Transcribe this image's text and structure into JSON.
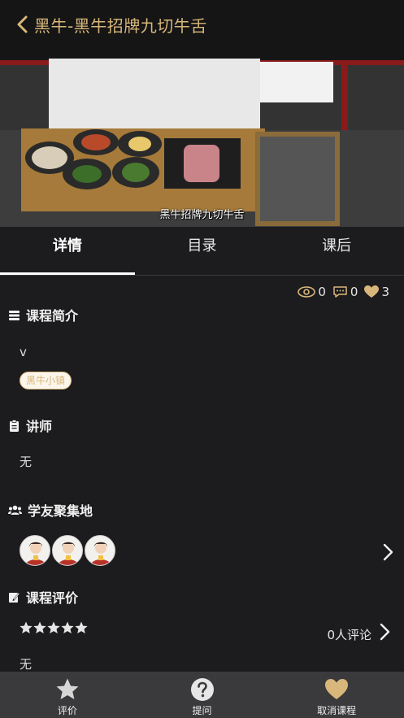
{
  "header": {
    "title": "黑牛-黑牛招牌九切牛舌",
    "video_subtitle": "黑牛招牌九切牛舌"
  },
  "tabs": [
    {
      "label": "详情",
      "active": true
    },
    {
      "label": "目录",
      "active": false
    },
    {
      "label": "课后",
      "active": false
    }
  ],
  "stats": {
    "views": "0",
    "comments": "0",
    "likes": "3"
  },
  "course_intro": {
    "heading": "课程简介",
    "text": "v",
    "tag": "黑牛小镇"
  },
  "lecturer": {
    "heading": "讲师",
    "text": "无"
  },
  "classmates": {
    "heading": "学友聚集地",
    "avatar_count": 3
  },
  "course_review": {
    "heading": "课程评价",
    "rating": 5,
    "comment_count_text": "0人评论",
    "text": "无"
  },
  "bottom_bar": [
    {
      "label": "评价",
      "icon": "star-icon"
    },
    {
      "label": "提问",
      "icon": "question-icon"
    },
    {
      "label": "取消课程",
      "icon": "heart-icon"
    }
  ],
  "colors": {
    "accent_gold": "#d9b77a",
    "background": "#1c1c1e",
    "bottom_bar": "#3a3a3c"
  }
}
